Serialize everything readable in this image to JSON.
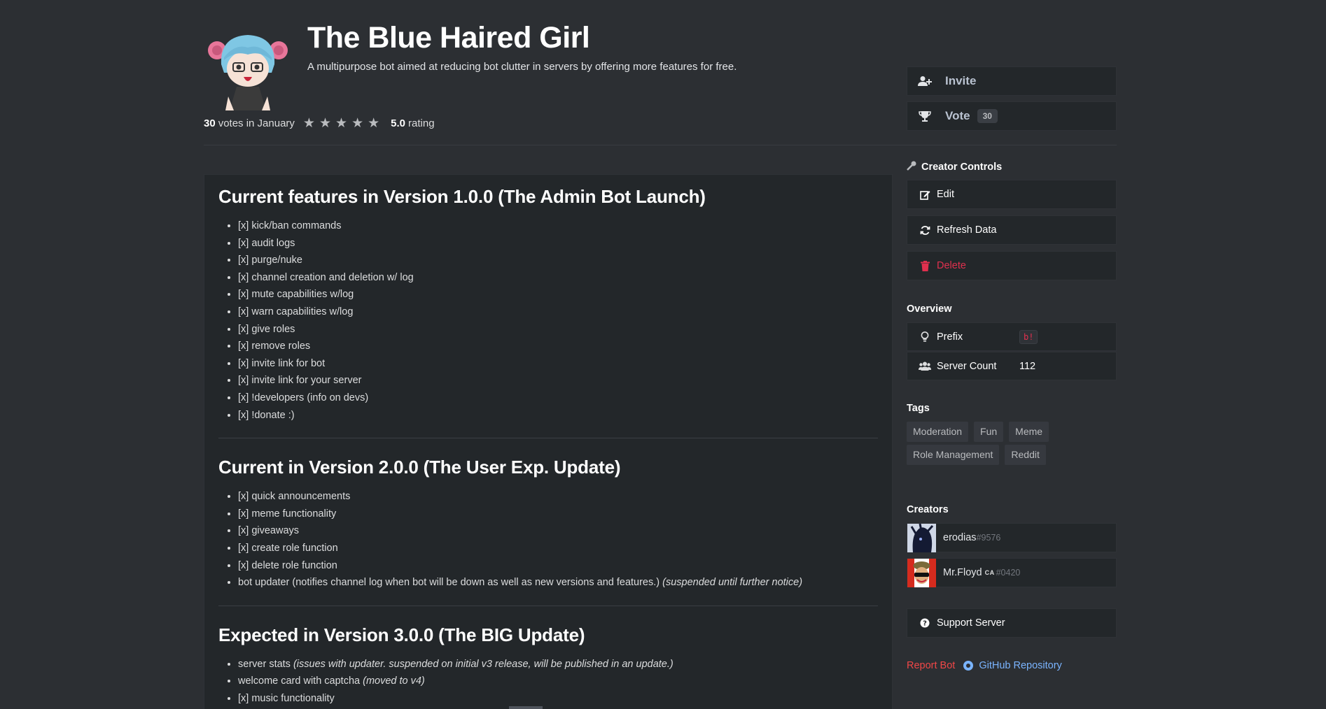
{
  "bot": {
    "name": "The Blue Haired Girl",
    "description": "A multipurpose bot aimed at reducing bot clutter in servers by offering more features for free."
  },
  "rating": {
    "votes": "30",
    "votes_suffix": "votes in January",
    "stars": 5,
    "value": "5.0",
    "value_suffix": "rating"
  },
  "actions": {
    "invite_label": "Invite",
    "vote_label": "Vote",
    "vote_count": "30"
  },
  "creator_controls": {
    "heading": "Creator Controls",
    "edit_label": "Edit",
    "refresh_label": "Refresh Data",
    "delete_label": "Delete"
  },
  "overview": {
    "heading": "Overview",
    "prefix_label": "Prefix",
    "prefix_value": "b!",
    "server_count_label": "Server Count",
    "server_count_value": "112"
  },
  "tags": {
    "heading": "Tags",
    "items": [
      "Moderation",
      "Fun",
      "Meme",
      "Role Management",
      "Reddit"
    ]
  },
  "creators": {
    "heading": "Creators",
    "items": [
      {
        "name": "erodias",
        "discriminator": "#9576",
        "flag": ""
      },
      {
        "name": "Mr.Floyd",
        "discriminator": "#0420",
        "flag": "CA"
      }
    ]
  },
  "support_label": "Support Server",
  "links": {
    "report": "Report Bot",
    "github": "GitHub Repository"
  },
  "description": {
    "sections": [
      {
        "title": "Current features in Version 1.0.0 (The Admin Bot Launch)",
        "items": [
          {
            "text": "[x] kick/ban commands",
            "note": ""
          },
          {
            "text": "[x] audit logs",
            "note": ""
          },
          {
            "text": "[x] purge/nuke",
            "note": ""
          },
          {
            "text": "[x] channel creation and deletion w/ log",
            "note": ""
          },
          {
            "text": "[x] mute capabilities w/log",
            "note": ""
          },
          {
            "text": "[x] warn capabilities w/log",
            "note": ""
          },
          {
            "text": "[x] give roles",
            "note": ""
          },
          {
            "text": "[x] remove roles",
            "note": ""
          },
          {
            "text": "[x] invite link for bot",
            "note": ""
          },
          {
            "text": "[x] invite link for your server",
            "note": ""
          },
          {
            "text": "[x] !developers (info on devs)",
            "note": ""
          },
          {
            "text": "[x] !donate :)",
            "note": ""
          }
        ]
      },
      {
        "title": "Current in Version 2.0.0 (The User Exp. Update)",
        "items": [
          {
            "text": "[x] quick announcements",
            "note": ""
          },
          {
            "text": "[x] meme functionality",
            "note": ""
          },
          {
            "text": "[x] giveaways",
            "note": ""
          },
          {
            "text": "[x] create role function",
            "note": ""
          },
          {
            "text": "[x] delete role function",
            "note": ""
          },
          {
            "text": "bot updater (notifies channel log when bot will be down as well as new versions and features.)",
            "note": "(suspended until further notice)"
          }
        ]
      },
      {
        "title": "Expected in Version 3.0.0 (The BIG Update)",
        "items": [
          {
            "text": "server stats",
            "note": "(issues with updater. suspended on initial v3 release, will be published in an update.)"
          },
          {
            "text": "welcome card with captcha",
            "note": "(moved to v4)"
          },
          {
            "text": "[x] music functionality",
            "note": ""
          }
        ]
      }
    ]
  },
  "icons": {
    "invite": "user-plus-icon",
    "vote": "trophy-icon",
    "creator_controls": "key-icon",
    "edit": "edit-icon",
    "refresh": "refresh-icon",
    "delete": "trash-icon",
    "prefix": "lightbulb-icon",
    "server_count": "users-icon",
    "support": "question-circle-icon",
    "github": "github-icon"
  },
  "colors": {
    "background": "#2c2f33",
    "card": "#23272a",
    "danger": "#e0304e",
    "report": "#f04747",
    "link": "#7ab4ff"
  }
}
